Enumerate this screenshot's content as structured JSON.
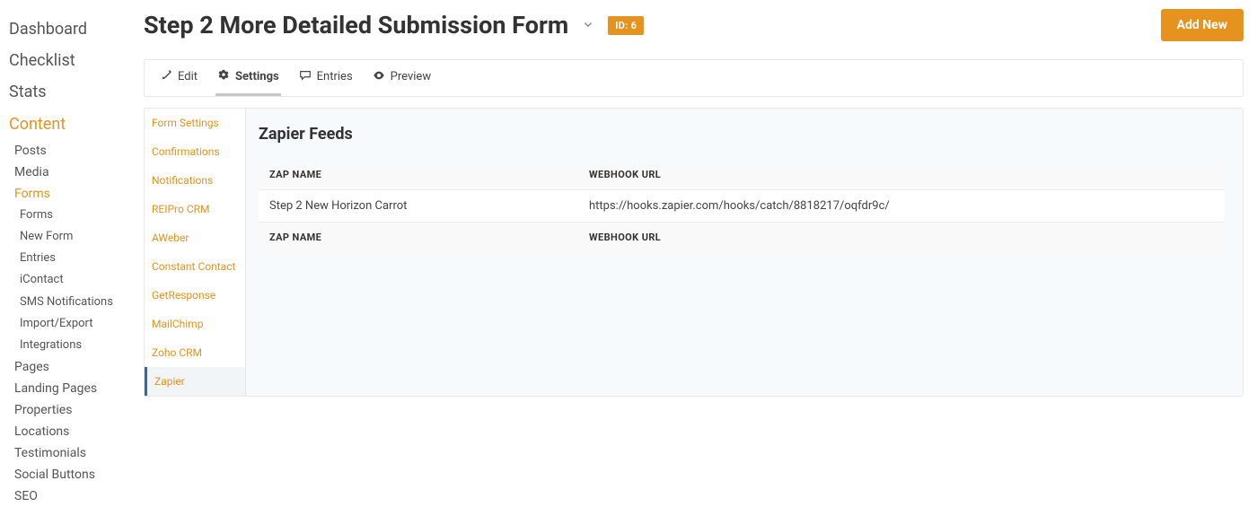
{
  "left_nav": {
    "dashboard": "Dashboard",
    "checklist": "Checklist",
    "stats": "Stats",
    "content": "Content",
    "posts": "Posts",
    "media": "Media",
    "forms": "Forms",
    "forms_sub": [
      "Forms",
      "New Form",
      "Entries",
      "iContact",
      "SMS Notifications",
      "Import/Export",
      "Integrations"
    ],
    "pages": "Pages",
    "landing_pages": "Landing Pages",
    "properties": "Properties",
    "locations": "Locations",
    "testimonials": "Testimonials",
    "social_buttons": "Social Buttons",
    "seo": "SEO"
  },
  "header": {
    "title": "Step 2 More Detailed Submission Form",
    "id_badge": "ID: 6",
    "add_new": "Add New"
  },
  "tabs": {
    "edit": "Edit",
    "settings": "Settings",
    "entries": "Entries",
    "preview": "Preview"
  },
  "settings_side": {
    "form_settings": "Form Settings",
    "confirmations": "Confirmations",
    "notifications": "Notifications",
    "reipro_crm": "REIPro CRM",
    "aweber": "AWeber",
    "constant_contact": "Constant Contact",
    "getresponse": "GetResponse",
    "mailchimp": "MailChimp",
    "zoho_crm": "Zoho CRM",
    "zapier": "Zapier"
  },
  "content": {
    "title": "Zapier Feeds",
    "col_zap_name": "ZAP NAME",
    "col_webhook_url": "WEBHOOK URL",
    "rows": [
      {
        "zap_name": "Step 2 New Horizon Carrot",
        "webhook_url": "https://hooks.zapier.com/hooks/catch/8818217/oqfdr9c/"
      }
    ]
  }
}
